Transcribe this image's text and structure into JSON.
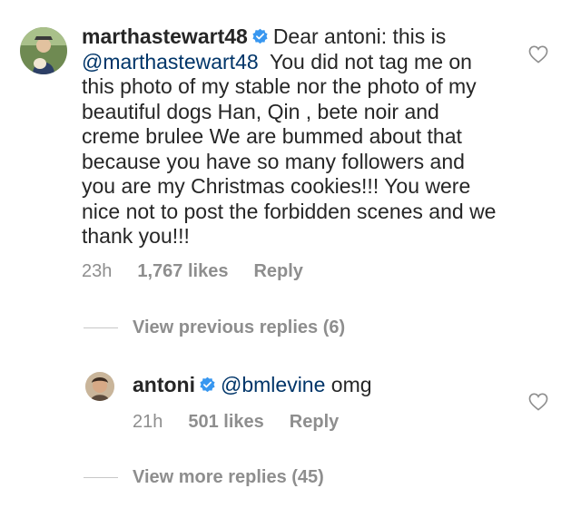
{
  "main_comment": {
    "username": "marthastewart48",
    "verified": true,
    "text_intro": "Dear antoni: this is",
    "mention": "@marthastewart48",
    "text_body": "You did not tag me on this photo of my stable nor the photo of my beautiful dogs Han, Qin , bete noir and creme brulee  We are bummed about that because you have so many followers and you are my Christmas cookies!!! You  were nice not to post the forbidden scenes and we thank you!!!",
    "time": "23h",
    "likes": "1,767 likes",
    "reply_label": "Reply"
  },
  "view_previous_replies": "View previous replies (6)",
  "reply_comment": {
    "username": "antoni",
    "verified": true,
    "mention": "@bmlevine",
    "text": "omg",
    "time": "21h",
    "likes": "501 likes",
    "reply_label": "Reply"
  },
  "view_more_replies": "View more replies (45)",
  "colors": {
    "text": "#262626",
    "secondary": "#8e8e8e",
    "mention": "#003569",
    "verified": "#3897f0"
  },
  "icons": [
    "heart-icon",
    "verified-badge-icon"
  ]
}
